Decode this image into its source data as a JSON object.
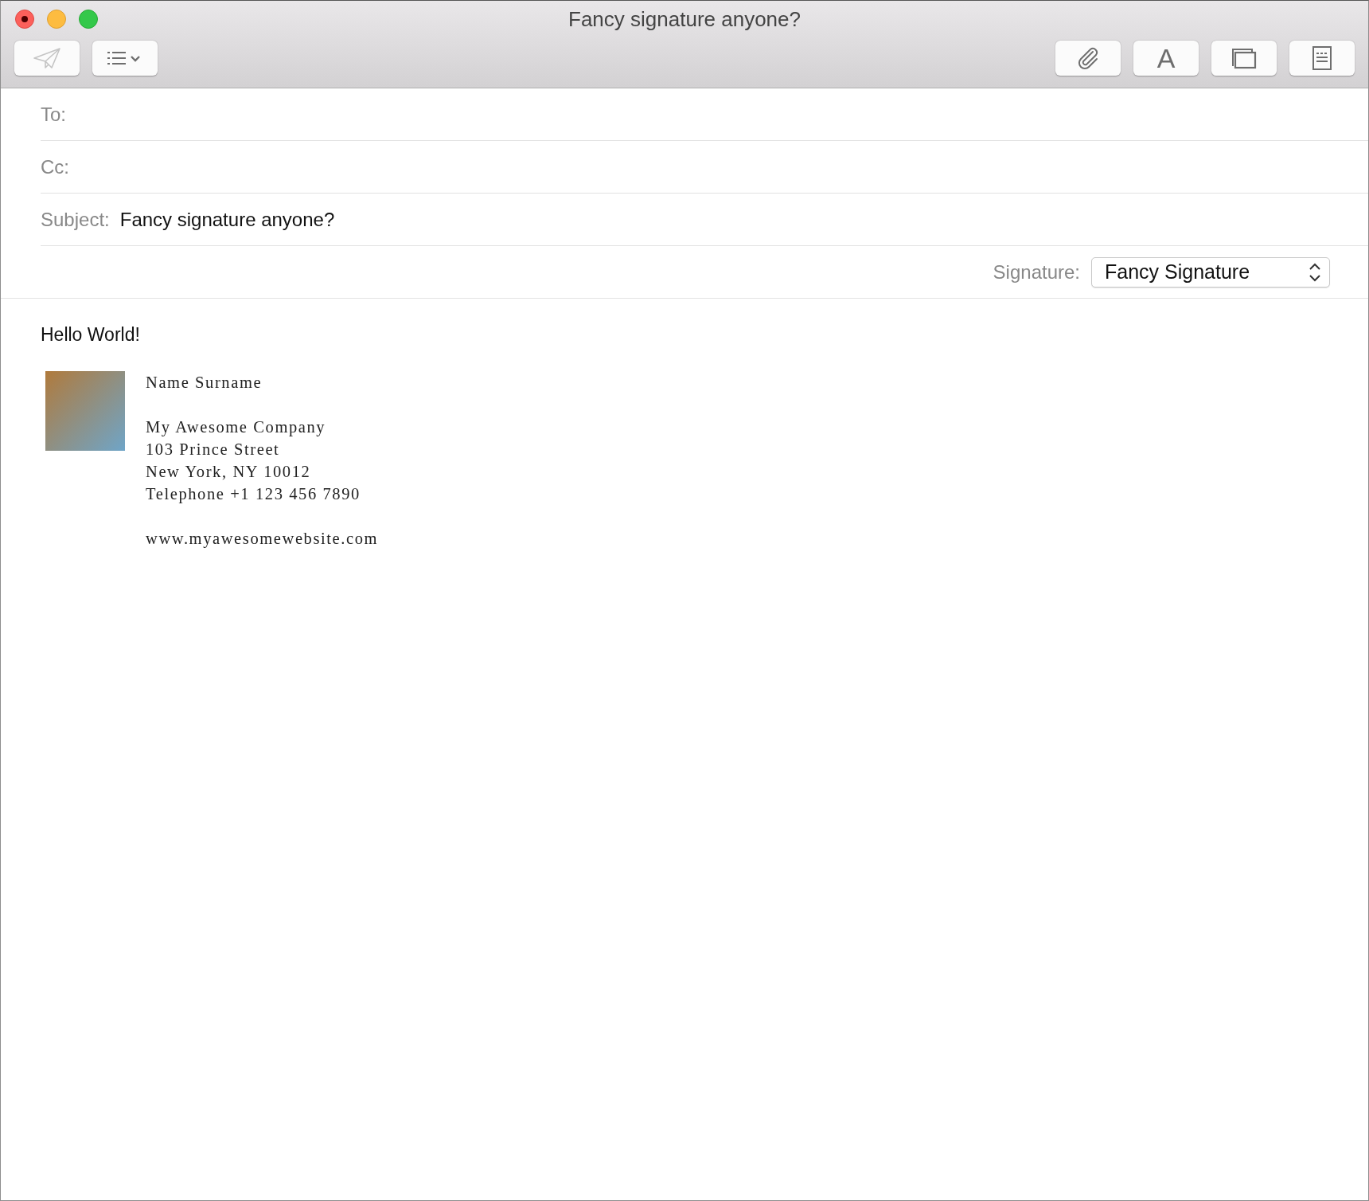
{
  "window": {
    "title": "Fancy signature anyone?"
  },
  "toolbar": {
    "left": [
      {
        "kind": "send",
        "disabled": true
      },
      {
        "kind": "format-list",
        "disabled": false
      }
    ],
    "right": [
      {
        "kind": "attach"
      },
      {
        "kind": "font",
        "label": "A"
      },
      {
        "kind": "browser"
      },
      {
        "kind": "template"
      }
    ]
  },
  "fields": [
    {
      "label": "To:"
    },
    {
      "label": "Cc:"
    },
    {
      "label": "Subject:",
      "value": "Fancy signature anyone?"
    }
  ],
  "signature_picker": {
    "label": "Signature:",
    "value": "Fancy Signature"
  },
  "body": {
    "greeting": "Hello World!",
    "signature": {
      "blocks": [
        [
          "Name Surname"
        ],
        [
          "My Awesome Company",
          "103 Prince Street",
          "New York, NY 10012",
          "Telephone +1 123 456 7890"
        ],
        [
          "www.myawesomewebsite.com"
        ]
      ]
    }
  }
}
